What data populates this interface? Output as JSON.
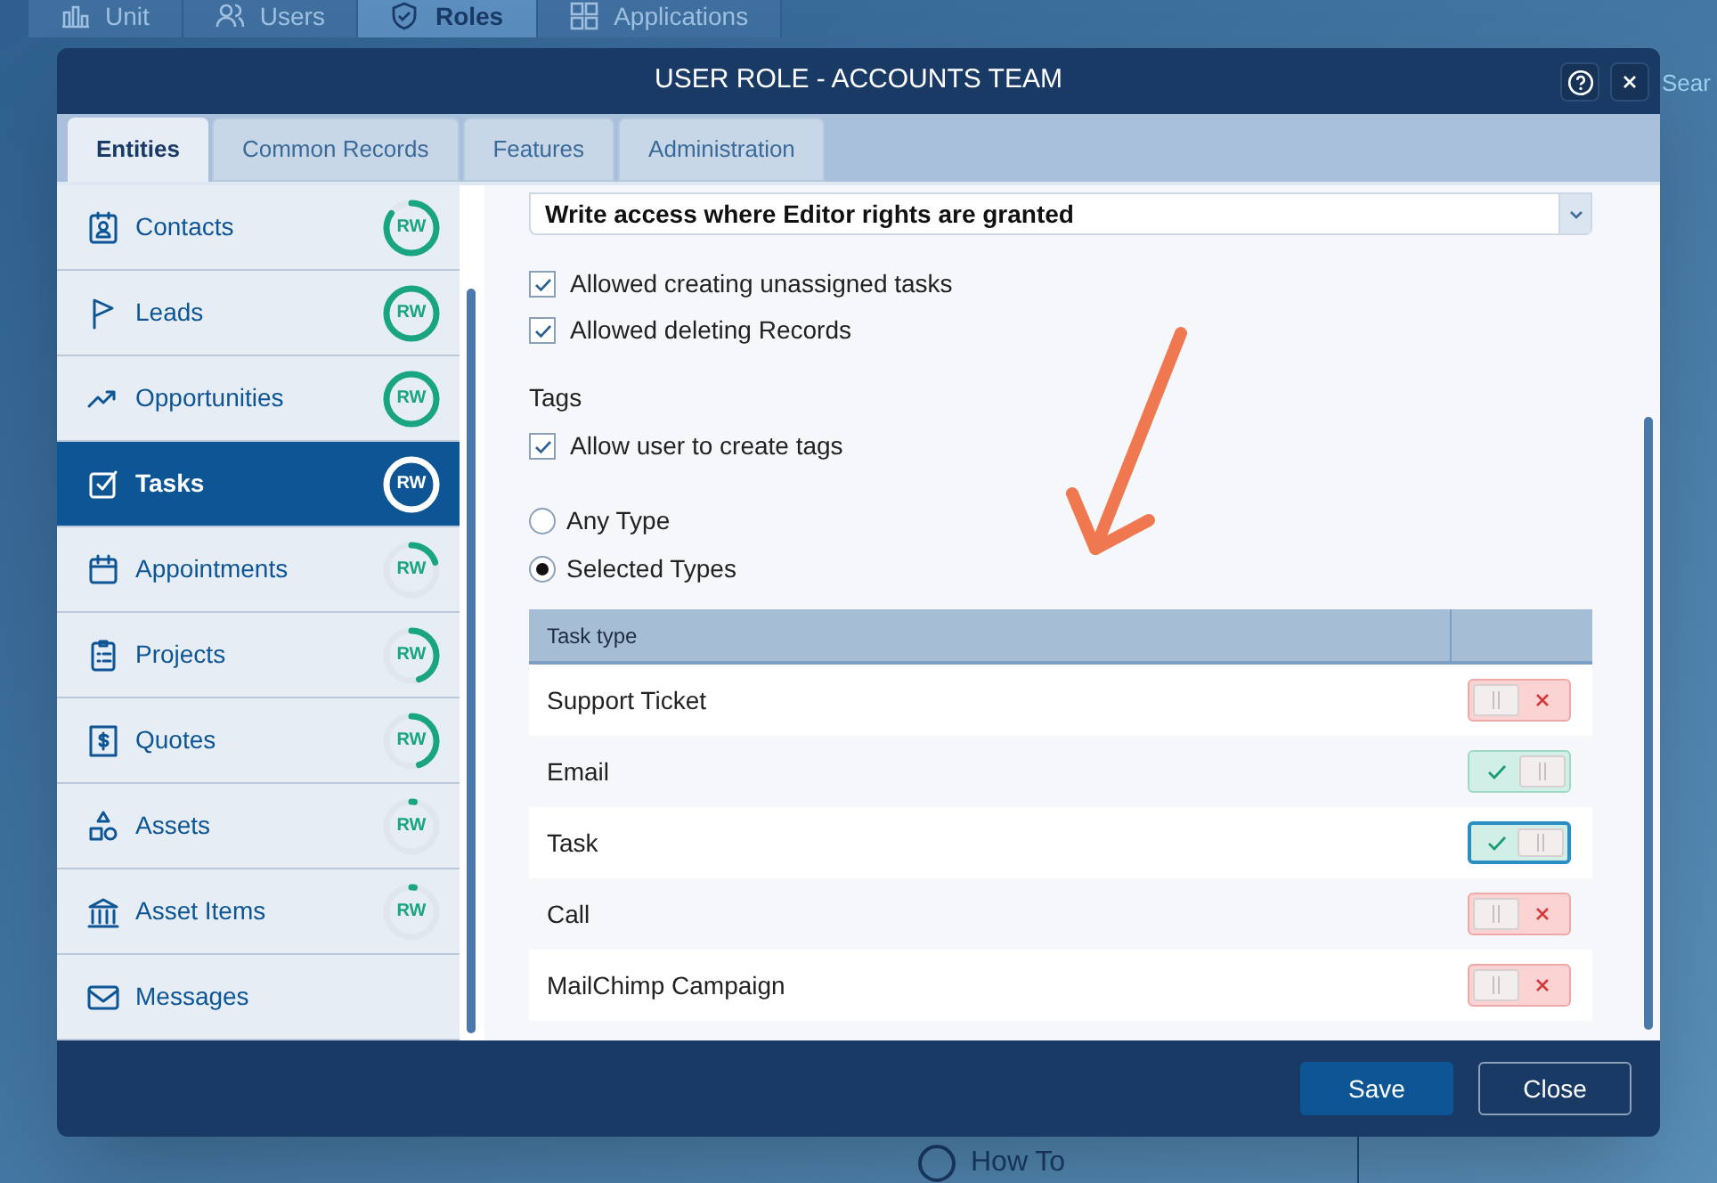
{
  "background": {
    "tabs": [
      {
        "label": "Unit",
        "selected": false
      },
      {
        "label": "Users",
        "selected": false
      },
      {
        "label": "Roles",
        "selected": true
      },
      {
        "label": "Applications",
        "selected": false
      }
    ],
    "search_button": "Sear",
    "help_link": "How To"
  },
  "dialog": {
    "title": "USER ROLE - ACCOUNTS TEAM",
    "tabs": [
      {
        "label": "Entities",
        "selected": true
      },
      {
        "label": "Common Records",
        "selected": false
      },
      {
        "label": "Features",
        "selected": false
      },
      {
        "label": "Administration",
        "selected": false
      }
    ],
    "entities": [
      {
        "label": "Contacts",
        "selected": false,
        "badge": "RW",
        "level": 0.85
      },
      {
        "label": "Leads",
        "selected": false,
        "badge": "RW",
        "level": 1
      },
      {
        "label": "Opportunities",
        "selected": false,
        "badge": "RW",
        "level": 1
      },
      {
        "label": "Tasks",
        "selected": true,
        "badge": "RW",
        "level": 1
      },
      {
        "label": "Appointments",
        "selected": false,
        "badge": "RW",
        "level": 0.2
      },
      {
        "label": "Projects",
        "selected": false,
        "badge": "RW",
        "level": 0.45
      },
      {
        "label": "Quotes",
        "selected": false,
        "badge": "RW",
        "level": 0.45
      },
      {
        "label": "Assets",
        "selected": false,
        "badge": "RW",
        "level": 0.02
      },
      {
        "label": "Asset Items",
        "selected": false,
        "badge": "RW",
        "level": 0.02
      },
      {
        "label": "Messages",
        "selected": false
      }
    ],
    "access_select": {
      "value": "Write access where Editor rights are granted"
    },
    "options": [
      {
        "label": "Allowed creating unassigned tasks",
        "checked": true
      },
      {
        "label": "Allowed deleting Records",
        "checked": true
      }
    ],
    "tags_heading": "Tags",
    "tag_options": [
      {
        "label": "Allow user to create tags",
        "checked": true
      }
    ],
    "type_scope": [
      {
        "label": "Any Type",
        "selected": false
      },
      {
        "label": "Selected Types",
        "selected": true
      }
    ],
    "table": {
      "columns": [
        "Task type"
      ],
      "rows": [
        {
          "name": "Support Ticket",
          "on": false,
          "focused": false
        },
        {
          "name": "Email",
          "on": true,
          "focused": false
        },
        {
          "name": "Task",
          "on": true,
          "focused": true
        },
        {
          "name": "Call",
          "on": false,
          "focused": false
        },
        {
          "name": "MailChimp Campaign",
          "on": false,
          "focused": false
        }
      ]
    },
    "buttons": [
      {
        "label": "Save",
        "kind": "primary"
      },
      {
        "label": "Close",
        "kind": "secondary"
      }
    ]
  }
}
